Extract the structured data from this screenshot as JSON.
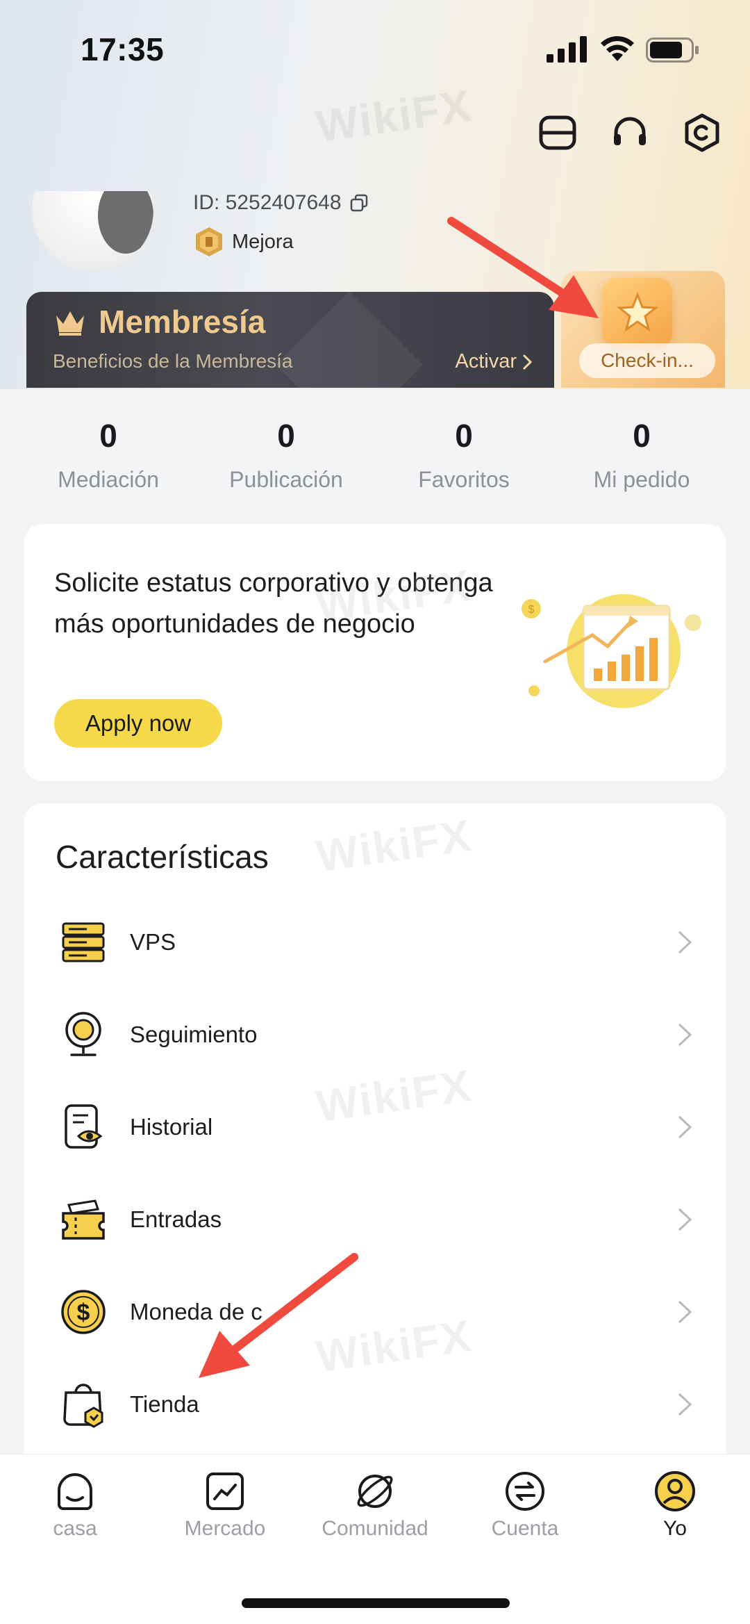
{
  "status_bar": {
    "time": "17:35"
  },
  "profile": {
    "id_text": "ID: 5252407648",
    "level_label": "Mejora"
  },
  "membership": {
    "title": "Membresía",
    "subtitle": "Beneficios de la Membresía",
    "activate_label": "Activar"
  },
  "checkin": {
    "label": "Check-in..."
  },
  "stats": [
    {
      "value": "0",
      "label": "Mediación"
    },
    {
      "value": "0",
      "label": "Publicación"
    },
    {
      "value": "0",
      "label": "Favoritos"
    },
    {
      "value": "0",
      "label": "Mi pedido"
    }
  ],
  "corporate": {
    "text": "Solicite estatus corporativo y obtenga más oportunidades de negocio",
    "button_label": "Apply now"
  },
  "features": {
    "title": "Características",
    "items": [
      {
        "label": "VPS",
        "icon": "server-icon"
      },
      {
        "label": "Seguimiento",
        "icon": "webcam-icon"
      },
      {
        "label": "Historial",
        "icon": "document-eye-icon"
      },
      {
        "label": "Entradas",
        "icon": "ticket-icon"
      },
      {
        "label": "Moneda de c",
        "icon": "dollar-coin-icon"
      },
      {
        "label": "Tienda",
        "icon": "shopping-bag-icon"
      }
    ]
  },
  "tabs": [
    {
      "label": "casa",
      "icon": "home-icon"
    },
    {
      "label": "Mercado",
      "icon": "market-chart-icon"
    },
    {
      "label": "Comunidad",
      "icon": "community-planet-icon"
    },
    {
      "label": "Cuenta",
      "icon": "account-exchange-icon"
    },
    {
      "label": "Yo",
      "icon": "profile-icon"
    }
  ],
  "watermark_text": "WikiFX",
  "colors": {
    "accent_yellow": "#f6d94a",
    "membership_gold": "#f0c98e",
    "annotation_arrow": "#f04a3e"
  }
}
